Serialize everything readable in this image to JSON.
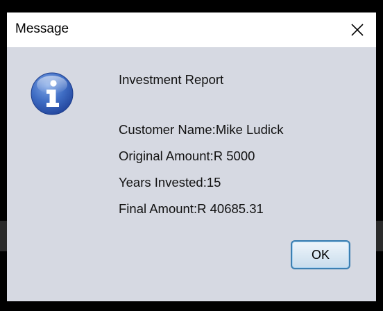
{
  "dialog": {
    "title": "Message",
    "close_icon": "close-icon",
    "icon": "information-icon",
    "icon_color": "#3560b8",
    "message_lines": [
      "Investment Report",
      "",
      "Customer Name:Mike Ludick",
      "Original Amount:R 5000",
      "Years Invested:15",
      "Final Amount:R 40685.31"
    ],
    "ok_label": "OK"
  }
}
